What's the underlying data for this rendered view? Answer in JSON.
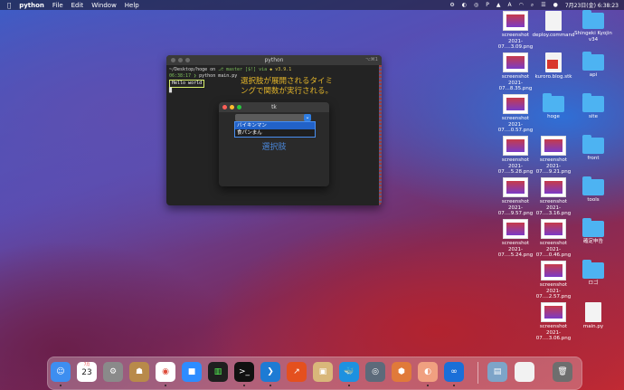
{
  "menubar": {
    "app_name": "python",
    "menus": [
      "File",
      "Edit",
      "Window",
      "Help"
    ],
    "clock": "7月23日(金)  6:38:23"
  },
  "desktop": {
    "items": [
      {
        "label": "screenshot\n2021-07....3.09.png",
        "kind": "thumb"
      },
      {
        "label": "deploy.command",
        "kind": "doc"
      },
      {
        "label": "Shingeki Kyojin\nv34",
        "kind": "folder"
      },
      {
        "label": "screenshot\n2021-07...8.35.png",
        "kind": "thumb"
      },
      {
        "label": "kuroro.blog.stk",
        "kind": "doc-red"
      },
      {
        "label": "api",
        "kind": "folder"
      },
      {
        "label": "screenshot\n2021-07....0.57.png",
        "kind": "thumb"
      },
      {
        "label": "hoge",
        "kind": "folder"
      },
      {
        "label": "site",
        "kind": "folder"
      },
      {
        "label": "screenshot\n2021-07....5.28.png",
        "kind": "thumb"
      },
      {
        "label": "screenshot\n2021-07....9.21.png",
        "kind": "thumb"
      },
      {
        "label": "front",
        "kind": "folder"
      },
      {
        "label": "screenshot\n2021-07....9.57.png",
        "kind": "thumb"
      },
      {
        "label": "screenshot\n2021-07....3.16.png",
        "kind": "thumb"
      },
      {
        "label": "tools",
        "kind": "folder"
      },
      {
        "label": "screenshot\n2021-07....5.24.png",
        "kind": "thumb"
      },
      {
        "label": "screenshot\n2021-07....0.46.png",
        "kind": "thumb"
      },
      {
        "label": "確定申告",
        "kind": "folder"
      },
      {
        "label": "screenshot\n2021-07....2.57.png",
        "kind": "thumb"
      },
      {
        "label": "ロゴ",
        "kind": "folder"
      },
      {
        "label": "screenshot\n2021-07....3.06.png",
        "kind": "thumb"
      },
      {
        "label": "main.py",
        "kind": "doc"
      }
    ]
  },
  "terminal": {
    "title": "python",
    "shortcut": "⌥⌘1",
    "line1_path": "~/Desktop/hoge on",
    "line1_branch": "master [$!] via",
    "line1_version": "v3.9.1",
    "line2_time": "06:38:17",
    "line2_cmd": "python main.py",
    "hello": "Hello world",
    "cursor": "█"
  },
  "annotation": {
    "line1": "選択肢が展開されるタイミ",
    "line2": "ングで関数が実行される。"
  },
  "tk": {
    "title": "tk",
    "combo_arrow": "⌄",
    "options": [
      "バイキンマン",
      "食パンまん"
    ],
    "selected_index": 0,
    "label": "選択肢"
  },
  "dock": {
    "calendar_month": "7月",
    "calendar_day": "23"
  },
  "colors": {
    "accent": "#2f7de1",
    "annotation": "#e3b52a",
    "label": "#4a86d8",
    "highlight": "#d9f06b"
  }
}
